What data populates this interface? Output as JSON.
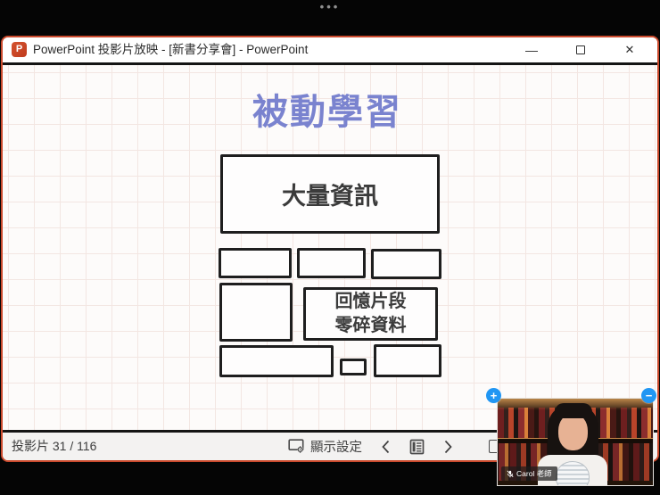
{
  "screen_share_bar": {
    "handle_dots": "•••"
  },
  "window": {
    "title_bar": {
      "app_icon_letter": "P",
      "title": "PowerPoint 投影片放映 - [新書分享會] - PowerPoint"
    },
    "status_bar": {
      "slide_counter": "投影片 31 / 116",
      "display_settings_label": "顯示設定"
    }
  },
  "slide": {
    "title": "被動學習",
    "boxes": {
      "main": "大量資訊",
      "memory_line1": "回憶片段",
      "memory_line2": "零碎資料"
    }
  },
  "webcam": {
    "name_label": "Carol 老師"
  },
  "icons": {
    "overflow_dots": "•••",
    "minimize": "—",
    "close": "✕",
    "maximize": "window-maximize-box",
    "display_settings": "monitor-with-gear",
    "prev_slide": "chevron-left",
    "slide_menu": "notes-list",
    "next_slide": "chevron-right",
    "pen_partial": "pen-tools-partially-hidden",
    "mic_muted": "microphone-with-slash",
    "webcam_zoom_in": "+",
    "webcam_zoom_out": "−"
  },
  "colors": {
    "window_border": "#cb4a2d",
    "slide_title": "#7a83cf",
    "box_border": "#1e1e1e",
    "webcam_accent": "#2196f3",
    "powerpoint_logo": "#c03a1d"
  }
}
